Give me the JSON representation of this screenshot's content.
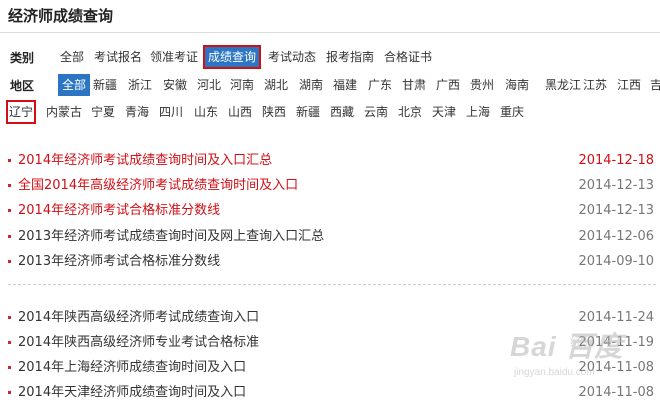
{
  "page": {
    "title": "经济师成绩查询"
  },
  "filters": {
    "category": {
      "label": "类别",
      "items": [
        {
          "label": "全部",
          "state": "plain"
        },
        {
          "label": "考试报名",
          "state": "plain"
        },
        {
          "label": "领准考证",
          "state": "plain"
        },
        {
          "label": "成绩查询",
          "state": "selected"
        },
        {
          "label": "考试动态",
          "state": "plain"
        },
        {
          "label": "报考指南",
          "state": "plain"
        },
        {
          "label": "合格证书",
          "state": "plain"
        }
      ]
    },
    "region": {
      "label": "地区",
      "rows": [
        [
          {
            "label": "全部",
            "state": "selected-filled"
          },
          {
            "label": "新疆",
            "state": "plain"
          },
          {
            "label": "浙江",
            "state": "plain"
          },
          {
            "label": "安徽",
            "state": "plain"
          },
          {
            "label": "河北",
            "state": "plain"
          },
          {
            "label": "河南",
            "state": "plain"
          },
          {
            "label": "湖北",
            "state": "plain"
          },
          {
            "label": "湖南",
            "state": "plain"
          },
          {
            "label": "福建",
            "state": "plain"
          },
          {
            "label": "广东",
            "state": "plain"
          },
          {
            "label": "甘肃",
            "state": "plain"
          },
          {
            "label": "广西",
            "state": "plain"
          },
          {
            "label": "贵州",
            "state": "plain"
          },
          {
            "label": "海南",
            "state": "plain"
          },
          {
            "label": "黑龙江",
            "state": "plain"
          },
          {
            "label": "江苏",
            "state": "plain"
          },
          {
            "label": "江西",
            "state": "plain"
          },
          {
            "label": "吉林",
            "state": "plain"
          }
        ],
        [
          {
            "label": "辽宁",
            "state": "outlined"
          },
          {
            "label": "内蒙古",
            "state": "plain"
          },
          {
            "label": "宁夏",
            "state": "plain"
          },
          {
            "label": "青海",
            "state": "plain"
          },
          {
            "label": "四川",
            "state": "plain"
          },
          {
            "label": "山东",
            "state": "plain"
          },
          {
            "label": "山西",
            "state": "plain"
          },
          {
            "label": "陕西",
            "state": "plain"
          },
          {
            "label": "新疆",
            "state": "plain"
          },
          {
            "label": "西藏",
            "state": "plain"
          },
          {
            "label": "云南",
            "state": "plain"
          },
          {
            "label": "北京",
            "state": "plain"
          },
          {
            "label": "天津",
            "state": "plain"
          },
          {
            "label": "上海",
            "state": "plain"
          },
          {
            "label": "重庆",
            "state": "plain"
          }
        ]
      ]
    }
  },
  "news_groups": [
    [
      {
        "title": "2014年经济师考试成绩查询时间及入口汇总",
        "date": "2014-12-18",
        "style": "hot-top"
      },
      {
        "title": "全国2014年高级经济师考试成绩查询时间及入口",
        "date": "2014-12-13",
        "style": "hot"
      },
      {
        "title": "2014年经济师考试合格标准分数线",
        "date": "2014-12-13",
        "style": "hot"
      },
      {
        "title": "2013年经济师考试成绩查询时间及网上查询入口汇总",
        "date": "2014-12-06",
        "style": "normal"
      },
      {
        "title": "2013年经济师考试合格标准分数线",
        "date": "2014-09-10",
        "style": "normal"
      }
    ],
    [
      {
        "title": "2014年陕西高级经济师考试成绩查询入口",
        "date": "2014-11-24",
        "style": "normal"
      },
      {
        "title": "2014年陕西高级经济师专业考试合格标准",
        "date": "2014-11-19",
        "style": "normal"
      },
      {
        "title": "2014年上海经济师成绩查询时间及入口",
        "date": "2014-11-08",
        "style": "normal"
      },
      {
        "title": "2014年天津经济师成绩查询时间及入口",
        "date": "2014-11-08",
        "style": "normal"
      }
    ]
  ],
  "colors": {
    "accent_red": "#d10f15",
    "accent_blue": "#2b75c2",
    "text": "#333333",
    "muted": "#777777"
  },
  "watermark": {
    "brand": "Bai 百度",
    "sub": "经验",
    "url": "jingyan.baidu.com"
  }
}
